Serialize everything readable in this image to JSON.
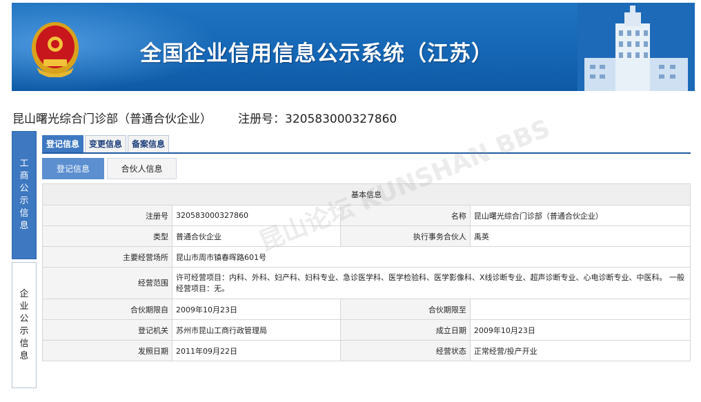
{
  "banner": {
    "title": "全国企业信用信息公示系统（江苏）"
  },
  "company": {
    "name": "昆山曙光综合门诊部（普通合伙企业）",
    "reg_label": "注册号：",
    "reg_no": "320583000327860"
  },
  "side_nav": [
    {
      "label_chars": [
        "工",
        "商",
        "公",
        "示",
        "信",
        "息"
      ],
      "active": true
    },
    {
      "label_chars": [
        "企",
        "业",
        "公",
        "示",
        "信",
        "息"
      ],
      "active": false
    }
  ],
  "tabs": [
    "登记信息",
    "变更信息",
    "备案信息"
  ],
  "subtabs": [
    "登记信息",
    "合伙人信息"
  ],
  "info": {
    "section_title": "基本信息",
    "rows": {
      "reg_no": {
        "label": "注册号",
        "value": "320583000327860"
      },
      "name": {
        "label": "名称",
        "value": "昆山曙光综合门诊部（普通合伙企业）"
      },
      "type": {
        "label": "类型",
        "value": "普通合伙企业"
      },
      "partner": {
        "label": "执行事务合伙人",
        "value": "禹英"
      },
      "address": {
        "label": "主要经营场所",
        "value": "昆山市周市镇春晖路601号"
      },
      "scope": {
        "label": "经营范围",
        "value": "许可经营项目：内科、外科、妇产科、妇科专业、急诊医学科、医学检验科、医学影像科、X线诊断专业、超声诊断专业、心电诊断专业、中医科。 一般经营项目：无。"
      },
      "term_from": {
        "label": "合伙期限自",
        "value": "2009年10月23日"
      },
      "term_to": {
        "label": "合伙期限至",
        "value": ""
      },
      "authority": {
        "label": "登记机关",
        "value": "苏州市昆山工商行政管理局"
      },
      "est_date": {
        "label": "成立日期",
        "value": "2009年10月23日"
      },
      "issue_date": {
        "label": "发照日期",
        "value": "2011年09月22日"
      },
      "status": {
        "label": "经营状态",
        "value": "正常经营/投产开业"
      }
    }
  },
  "watermark": "昆山论坛 KUNSHAN BBS"
}
